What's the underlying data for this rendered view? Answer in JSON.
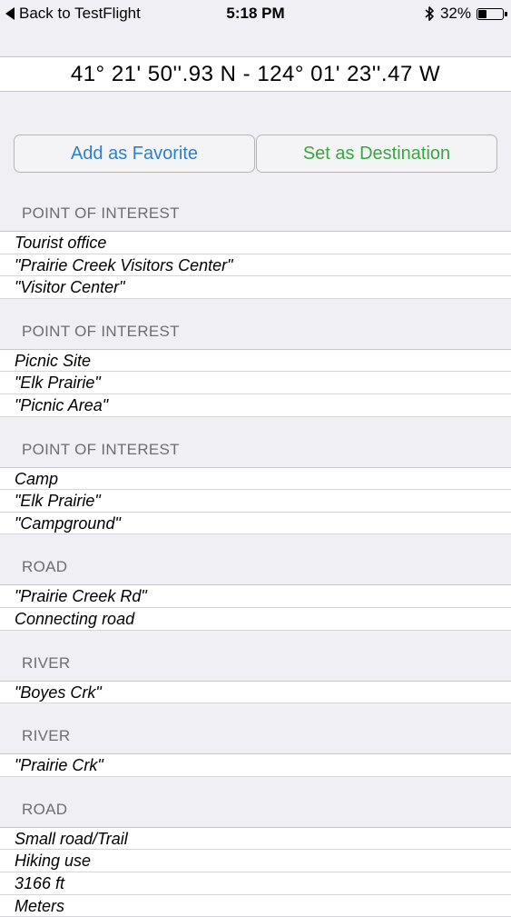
{
  "status_bar": {
    "back_label": "Back to TestFlight",
    "time": "5:18 PM",
    "battery_percent": "32%",
    "battery_level": 0.32
  },
  "coordinates": "41° 21' 50''.93 N  -  124° 01' 23''.47 W",
  "buttons": {
    "favorite": "Add as Favorite",
    "destination": "Set as Destination",
    "favorite_color": "#2d7fd1",
    "destination_color": "#3aa63e"
  },
  "sections": [
    {
      "header": "POINT OF INTEREST",
      "rows": [
        "Tourist office",
        "\"Prairie Creek Visitors Center\"",
        "\"Visitor Center\""
      ]
    },
    {
      "header": "POINT OF INTEREST",
      "rows": [
        "Picnic Site",
        "\"Elk Prairie\"",
        "\"Picnic Area\""
      ]
    },
    {
      "header": "POINT OF INTEREST",
      "rows": [
        "Camp",
        "\"Elk Prairie\"",
        "\"Campground\""
      ]
    },
    {
      "header": "ROAD",
      "rows": [
        "\"Prairie Creek Rd\"",
        "Connecting road"
      ]
    },
    {
      "header": "RIVER",
      "rows": [
        "\"Boyes Crk\""
      ]
    },
    {
      "header": "RIVER",
      "rows": [
        "\"Prairie Crk\""
      ]
    },
    {
      "header": "ROAD",
      "rows": [
        "Small road/Trail",
        "Hiking use",
        "3166 ft",
        "Meters"
      ]
    }
  ]
}
